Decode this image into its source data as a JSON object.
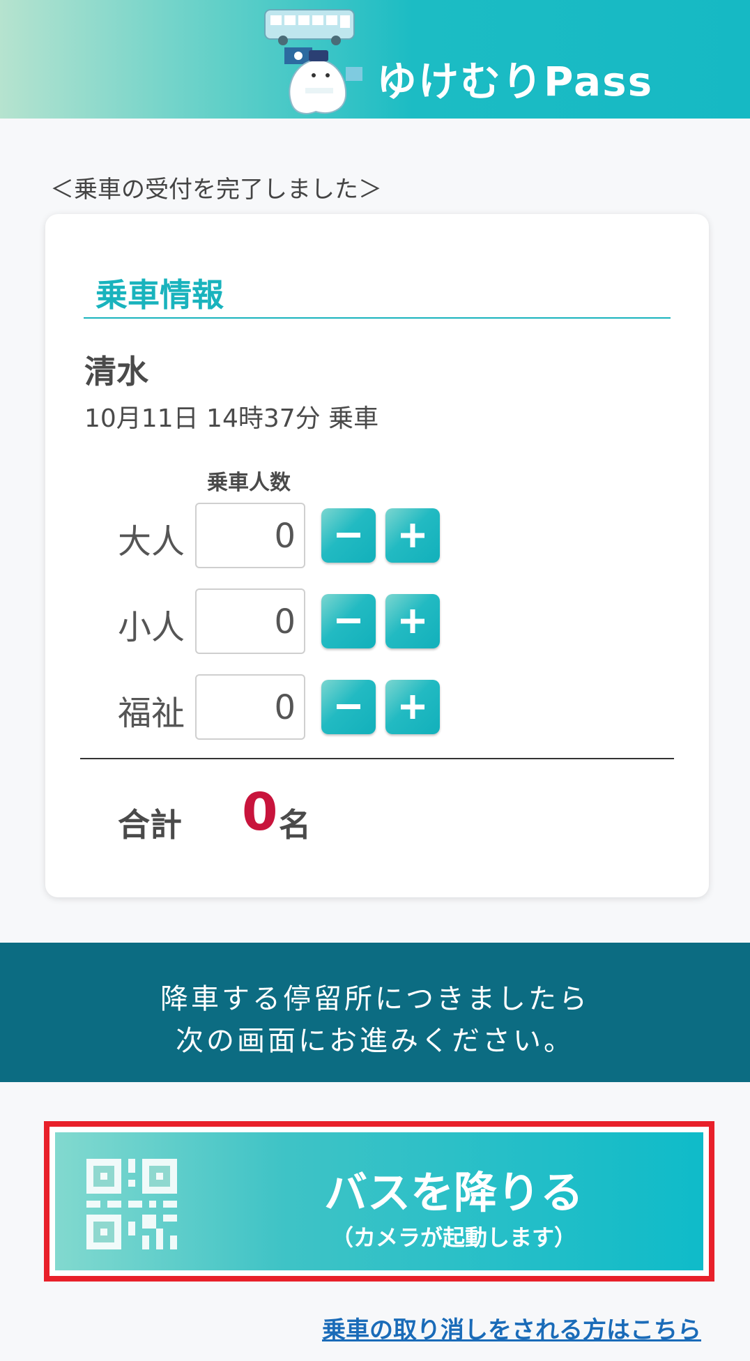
{
  "header": {
    "logo_text": "ゆけむりPass"
  },
  "status_message": "＜乗車の受付を完了しました＞",
  "card": {
    "title": "乗車情報",
    "stop_name": "清水",
    "boarding_time": "10月11日 14時37分 乗車",
    "count_header": "乗車人数",
    "passengers": [
      {
        "label": "大人",
        "value": "0"
      },
      {
        "label": "小人",
        "value": "0"
      },
      {
        "label": "福祉",
        "value": "0"
      }
    ],
    "total_label": "合計",
    "total_value": "0",
    "total_unit": "名"
  },
  "info": {
    "line1": "降車する停留所につきましたら",
    "line2": "次の画面にお進みください。"
  },
  "getoff": {
    "main_label": "バスを降りる",
    "sub_label": "（カメラが起動します）"
  },
  "cancel_link": "乗車の取り消しをされる方はこちら",
  "colors": {
    "accent": "#19b3bd",
    "band": "#0c6c82",
    "total": "#c8143c",
    "link": "#1a6bb8",
    "highlight_frame": "#e8202a"
  }
}
